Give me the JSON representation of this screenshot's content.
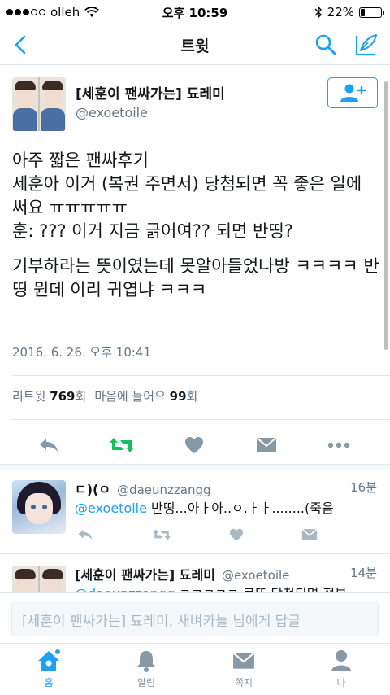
{
  "status_bar": {
    "carrier": "olleh",
    "time": "오후 10:59",
    "battery_percent_label": "22%",
    "battery_level": 0.22
  },
  "navbar": {
    "title": "트윗"
  },
  "tweet": {
    "author_name": "[세훈이 팬싸가는] 됴레미",
    "author_handle": "@exoetoile",
    "text_paragraph_1": "아주 짧은 팬싸후기\n세훈아 이거 (복권 주면서) 당첨되면 꼭 좋은 일에 써요 ㅠㅠㅠㅠㅠ\n훈: ??? 이거 지금 긁어여?? 되면 반띵?",
    "text_paragraph_2": "기부하라는 뜻이였는데 못알아들었나방 ㅋㅋㅋㅋ 반띵 뭔데 이리 귀엽냐 ㅋㅋㅋ",
    "timestamp": "2016. 6. 26. 오후 10:41",
    "retweets_label": "리트윗",
    "retweets_count": "769",
    "retweets_unit": "회",
    "likes_label": "마음에 들어요",
    "likes_count": "99",
    "likes_unit": "회"
  },
  "replies": [
    {
      "name": "ㄷ)(ㅇ",
      "handle": "@daeunzzangg",
      "time": "16분",
      "mention": "@exoetoile",
      "text": " 반띵...아ㅏ아..ㅇ.ㅏㅏ........(죽음"
    },
    {
      "name": "[세훈이 팬싸가는] 됴레미",
      "handle": "@exoetoile",
      "time": "14분",
      "mention": "@daeunzzangg",
      "text": " ㅋㅋㅋㅋㅋ 로또 당첨되면 정부"
    }
  ],
  "composer": {
    "placeholder": "[세훈이 팬싸가는] 됴레미, 새벼카늘 님에게 답글"
  },
  "tabbar": {
    "home": "홈",
    "notifications": "알림",
    "messages": "쪽지",
    "me": "나"
  },
  "colors": {
    "accent": "#1da1f2",
    "retweet_green": "#17bf63",
    "icon_gray": "#8899a6"
  }
}
